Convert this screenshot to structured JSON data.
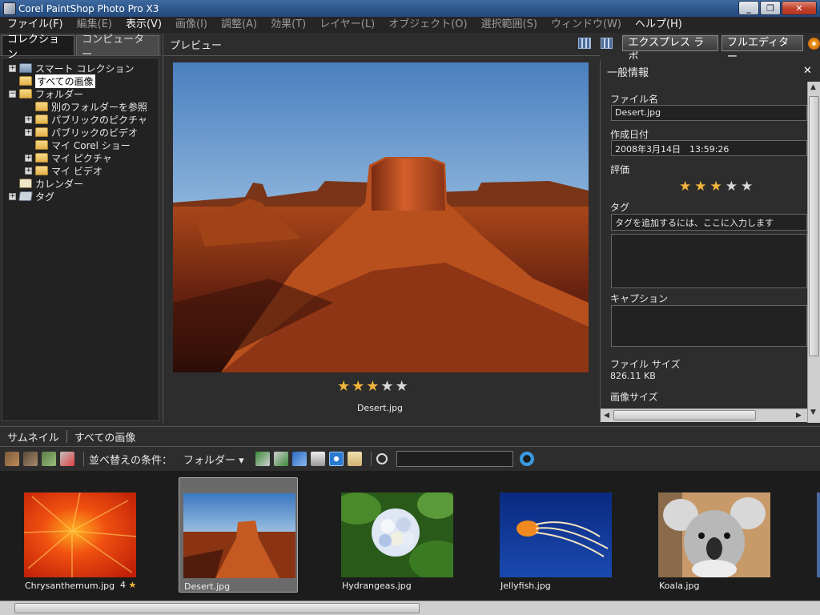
{
  "window": {
    "title": "Corel PaintShop Photo Pro X3",
    "buttons": [
      "_",
      "❐",
      "✕"
    ]
  },
  "menu": [
    {
      "label": "ファイル(F)",
      "dim": false
    },
    {
      "label": "編集(E)",
      "dim": true
    },
    {
      "label": "表示(V)",
      "dim": false
    },
    {
      "label": "画像(I)",
      "dim": true
    },
    {
      "label": "調整(A)",
      "dim": true
    },
    {
      "label": "効果(T)",
      "dim": true
    },
    {
      "label": "レイヤー(L)",
      "dim": true
    },
    {
      "label": "オブジェクト(O)",
      "dim": true
    },
    {
      "label": "選択範囲(S)",
      "dim": true
    },
    {
      "label": "ウィンドウ(W)",
      "dim": true
    },
    {
      "label": "ヘルプ(H)",
      "dim": false
    }
  ],
  "left_tabs": [
    "コレクション",
    "コンピューター"
  ],
  "tree": [
    {
      "label": "スマート コレクション",
      "indent": 0,
      "exp": "+",
      "icon": "smart"
    },
    {
      "label": "すべての画像",
      "indent": 0,
      "exp": "",
      "icon": "folder",
      "selected": true
    },
    {
      "label": "フォルダー",
      "indent": 0,
      "exp": "−",
      "icon": "folder"
    },
    {
      "label": "別のフォルダーを参照",
      "indent": 1,
      "exp": "",
      "icon": "folder"
    },
    {
      "label": "パブリックのピクチャ",
      "indent": 1,
      "exp": "+",
      "icon": "folder"
    },
    {
      "label": "パブリックのビデオ",
      "indent": 1,
      "exp": "+",
      "icon": "folder"
    },
    {
      "label": "マイ Corel ショー",
      "indent": 1,
      "exp": "",
      "icon": "folder"
    },
    {
      "label": "マイ ピクチャ",
      "indent": 1,
      "exp": "+",
      "icon": "folder"
    },
    {
      "label": "マイ ビデオ",
      "indent": 1,
      "exp": "+",
      "icon": "folder"
    },
    {
      "label": "カレンダー",
      "indent": 0,
      "exp": "",
      "icon": "cal"
    },
    {
      "label": "タグ",
      "indent": 0,
      "exp": "+",
      "icon": "tag"
    }
  ],
  "preview": {
    "title": "プレビュー",
    "filename": "Desert.jpg",
    "rating": 3,
    "max_rating": 5
  },
  "header_buttons": {
    "express_lab": "エクスプレス ラボ",
    "full_editor": "フルエディター"
  },
  "info": {
    "title": "一般情報",
    "close": "✕",
    "filename_label": "ファイル名",
    "filename": "Desert.jpg",
    "date_label": "作成日付",
    "date": "2008年3月14日　13:59:26",
    "rating_label": "評価",
    "rating": 3,
    "tag_label": "タグ",
    "tag_placeholder": "タグを追加するには、ここに入力します",
    "caption_label": "キャプション",
    "filesize_label": "ファイル サイズ",
    "filesize": "826.11 KB",
    "imagesize_label": "画像サイズ"
  },
  "thumb_header": {
    "tab1": "サムネイル",
    "tab2": "すべての画像"
  },
  "toolbar": {
    "sort_label": "並べ替えの条件：",
    "sort_value": "フォルダー"
  },
  "thumbnails": [
    {
      "name": "Chrysanthemum.jpg",
      "rating": "4",
      "selected": false,
      "kind": "chrys"
    },
    {
      "name": "Desert.jpg",
      "rating": "",
      "selected": true,
      "kind": "desert"
    },
    {
      "name": "Hydrangeas.jpg",
      "rating": "",
      "selected": false,
      "kind": "hydr"
    },
    {
      "name": "Jellyfish.jpg",
      "rating": "",
      "selected": false,
      "kind": "jelly"
    },
    {
      "name": "Koala.jpg",
      "rating": "",
      "selected": false,
      "kind": "koala"
    }
  ]
}
